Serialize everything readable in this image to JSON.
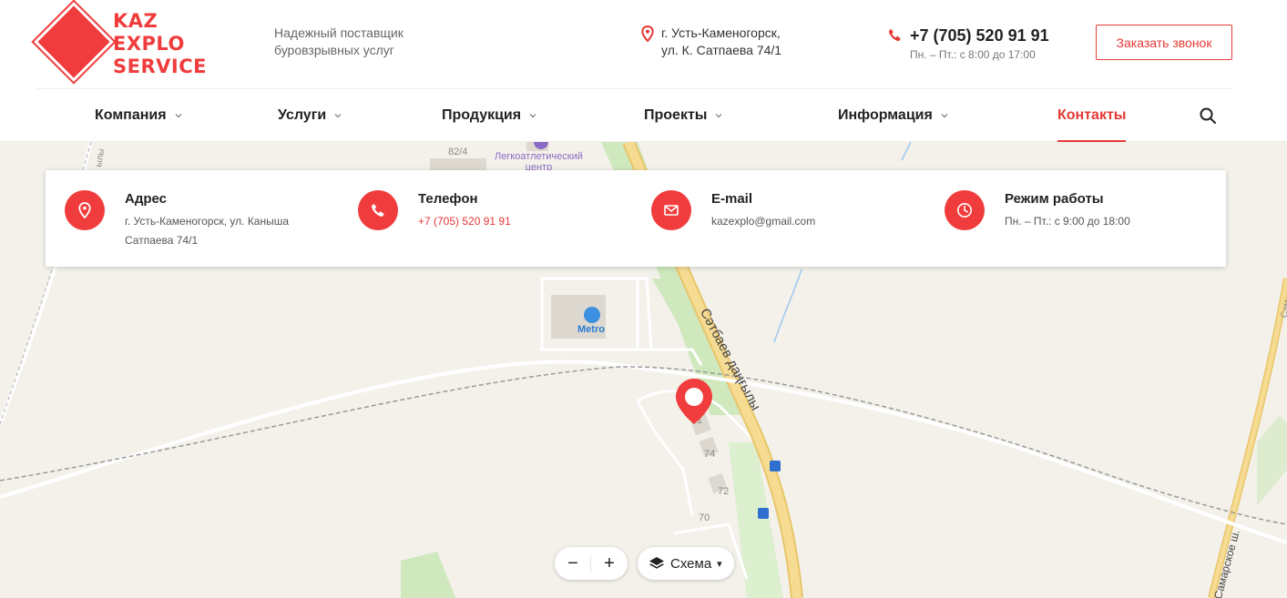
{
  "brand": {
    "logo_lines": [
      "KAZ",
      "EXPLO",
      "SERVICE"
    ],
    "color": "#f03c3c"
  },
  "header": {
    "tagline": [
      "Надежный поставщик",
      "буровзрывных услуг"
    ],
    "address": [
      "г. Усть-Каменогорск,",
      "ул. К. Сатпаева 74/1"
    ],
    "phone": "+7 (705) 520 91 91",
    "hours": "Пн. – Пт.: с 8:00 до 17:00",
    "callback_label": "Заказать звонок",
    "icons": {
      "address": "map-pin-icon",
      "phone": "phone-icon"
    }
  },
  "nav": {
    "items": [
      {
        "label": "Компания",
        "dropdown": true
      },
      {
        "label": "Услуги",
        "dropdown": true
      },
      {
        "label": "Продукция",
        "dropdown": true
      },
      {
        "label": "Проекты",
        "dropdown": true
      },
      {
        "label": "Информация",
        "dropdown": true
      },
      {
        "label": "Контакты",
        "dropdown": false,
        "active": true
      }
    ],
    "search_icon": "search-icon"
  },
  "contacts": [
    {
      "icon": "map-pin-icon",
      "title": "Адрес",
      "lines": [
        "г. Усть-Каменогорск, ул. Каныша",
        "Сатпаева 74/1"
      ]
    },
    {
      "icon": "phone-icon",
      "title": "Телефон",
      "lines": [
        "+7 (705) 520 91 91"
      ]
    },
    {
      "icon": "mail-icon",
      "title": "E-mail",
      "lines": [
        "kazexplo@gmail.com"
      ]
    },
    {
      "icon": "clock-icon",
      "title": "Режим работы",
      "lines": [
        "Пн. – Пт.: с 9:00 до 18:00"
      ]
    }
  ],
  "map": {
    "labels": {
      "building_82_4": "82/4",
      "stadium": [
        "Легкоатлетический",
        "центр"
      ],
      "metro": "Metro",
      "road_main": "Сәтбаев даңғылы",
      "road_right": "Самарское ш.",
      "house_1": "1",
      "house_74": "74",
      "house_72": "72",
      "house_70": "70",
      "left_road": "ылы",
      "right_edge": "Сам"
    },
    "controls": {
      "zoom_out": "−",
      "zoom_in": "+",
      "layers_label": "Схема",
      "layers_arrow": "▾"
    }
  },
  "colors": {
    "accent": "#e53935",
    "map_bg": "#f3f1ea",
    "road_yellow": "#f5d27a",
    "green": "#c8e6b0"
  }
}
